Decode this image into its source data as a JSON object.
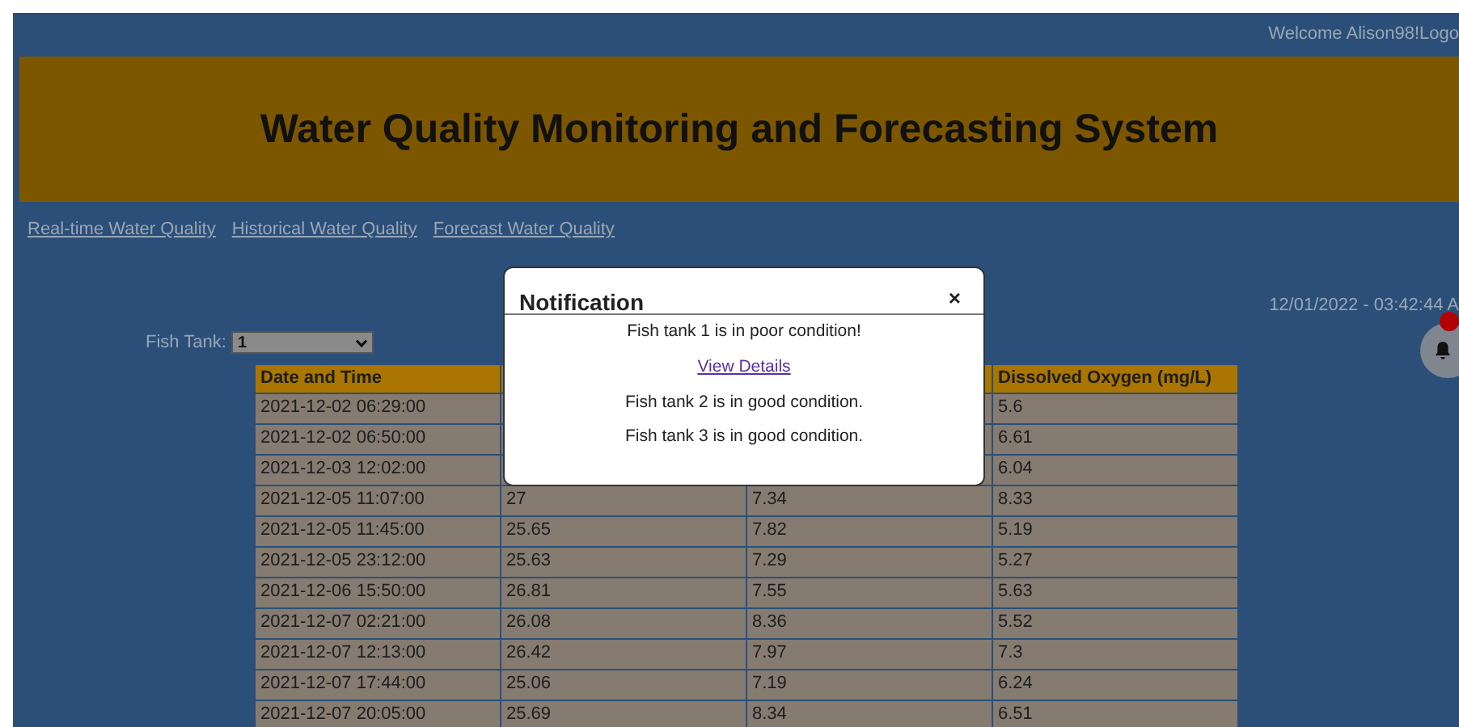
{
  "top_bar": {
    "welcome": "Welcome Alison98!",
    "logout_link": "Logo"
  },
  "header": {
    "title": "Water Quality Monitoring and Forecasting System"
  },
  "nav_links": [
    "Real-time Water Quality",
    "Historical Water Quality",
    "Forecast Water Quality"
  ],
  "datetime": "12/01/2022 - 03:42:44 A",
  "notification_bell": {
    "has_alert": true
  },
  "filter": {
    "label": "Fish Tank:",
    "value": "1"
  },
  "table": {
    "columns": [
      "Date and Time",
      null,
      null,
      "Dissolved Oxygen (mg/L)"
    ],
    "rows": [
      [
        "2021-12-02 06:29:00",
        null,
        null,
        "5.6"
      ],
      [
        "2021-12-02 06:50:00",
        null,
        null,
        "6.61"
      ],
      [
        "2021-12-03 12:02:00",
        null,
        null,
        "6.04"
      ],
      [
        "2021-12-05 11:07:00",
        "27",
        "7.34",
        "8.33"
      ],
      [
        "2021-12-05 11:45:00",
        "25.65",
        "7.82",
        "5.19"
      ],
      [
        "2021-12-05 23:12:00",
        "25.63",
        "7.29",
        "5.27"
      ],
      [
        "2021-12-06 15:50:00",
        "26.81",
        "7.55",
        "5.63"
      ],
      [
        "2021-12-07 02:21:00",
        "26.08",
        "8.36",
        "5.52"
      ],
      [
        "2021-12-07 12:13:00",
        "26.42",
        "7.97",
        "7.3"
      ],
      [
        "2021-12-07 17:44:00",
        "25.06",
        "7.19",
        "6.24"
      ],
      [
        "2021-12-07 20:05:00",
        "25.69",
        "8.34",
        "6.51"
      ]
    ]
  },
  "modal": {
    "title": "Notification",
    "close": "×",
    "messages": [
      {
        "kind": "text",
        "text": "Fish tank 1 is in poor condition!"
      },
      {
        "kind": "link",
        "text": "View Details"
      },
      {
        "kind": "text",
        "text": "Fish tank 2 is in good condition."
      },
      {
        "kind": "text",
        "text": "Fish tank 3 is in good condition."
      }
    ]
  }
}
